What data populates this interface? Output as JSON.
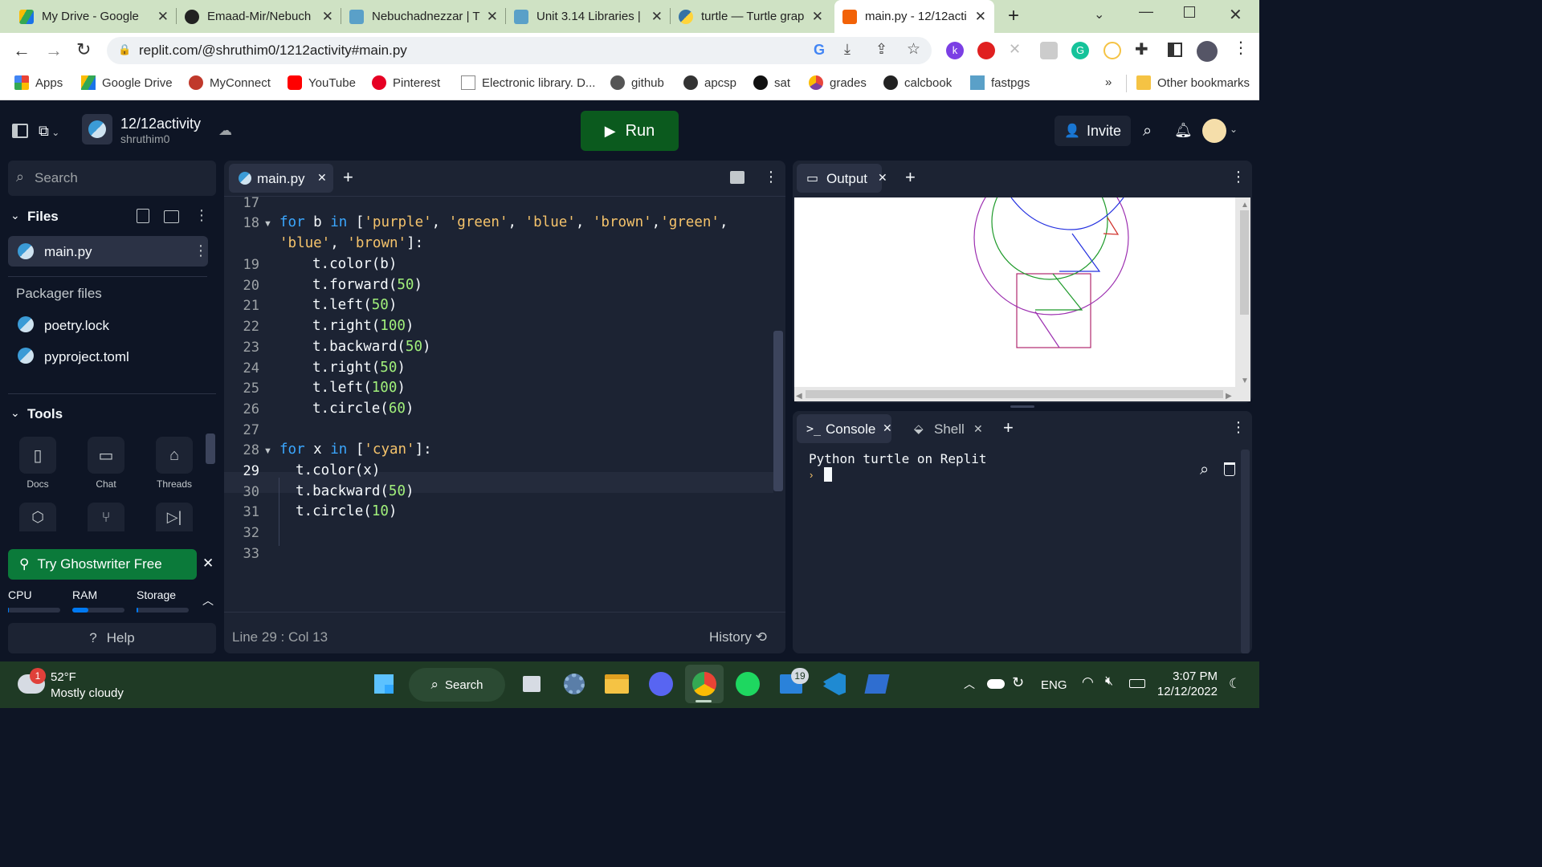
{
  "browser": {
    "tabs": [
      {
        "title": "My Drive - Google",
        "icon": "google-drive-icon",
        "color": "#1a73e8"
      },
      {
        "title": "Emaad-Mir/Nebuch",
        "icon": "github-icon",
        "color": "#222222"
      },
      {
        "title": "Nebuchadnezzar | T",
        "icon": "fastpages-icon",
        "color": "#5aa0c8"
      },
      {
        "title": "Unit 3.14 Libraries |",
        "icon": "fastpages-icon",
        "color": "#5aa0c8"
      },
      {
        "title": "turtle — Turtle grap",
        "icon": "python-icon",
        "color": "#3572a5"
      },
      {
        "title": "main.py - 12/12acti",
        "icon": "replit-icon",
        "color": "#f26207"
      }
    ],
    "url": "replit.com/@shruthim0/1212activity#main.py",
    "bookmarks": [
      {
        "label": "Apps",
        "color": "#4285f4"
      },
      {
        "label": "Google Drive",
        "color": "#fbbc04"
      },
      {
        "label": "MyConnect",
        "color": "#c0392b"
      },
      {
        "label": "YouTube",
        "color": "#ff0000"
      },
      {
        "label": "Pinterest",
        "color": "#e60023"
      },
      {
        "label": "Electronic library. D...",
        "color": "#888888"
      },
      {
        "label": "github",
        "color": "#555555"
      },
      {
        "label": "apcsp",
        "color": "#333333"
      },
      {
        "label": "sat",
        "color": "#111111"
      },
      {
        "label": "grades",
        "color": "#7b3fa0"
      },
      {
        "label": "calcbook",
        "color": "#222222"
      },
      {
        "label": "fastpgs",
        "color": "#5aa0c8"
      }
    ],
    "other_bookmarks": "Other bookmarks",
    "more": "»"
  },
  "replit": {
    "project_name": "12/12activity",
    "owner": "shruthim0",
    "run_label": "Run",
    "invite_label": "Invite",
    "search_placeholder": "Search",
    "files_label": "Files",
    "main_file": "main.py",
    "packager_label": "Packager files",
    "packager_files": [
      "poetry.lock",
      "pyproject.toml"
    ],
    "tools_label": "Tools",
    "tools": [
      "Docs",
      "Chat",
      "Threads"
    ],
    "ghostwriter_label": "Try Ghostwriter Free",
    "resources": {
      "cpu": "CPU",
      "ram": "RAM",
      "storage": "Storage",
      "cpu_level": 0.02,
      "ram_level": 0.3,
      "storage_level": 0.03
    },
    "help_label": "Help",
    "editor_tab": "main.py",
    "status_position": "Line 29 : Col 13",
    "history_label": "History",
    "output_tab": "Output",
    "console_tab": "Console",
    "shell_tab": "Shell",
    "console_text": "Python turtle on Replit"
  },
  "code_lines": [
    {
      "n": "17"
    },
    {
      "n": "18"
    },
    {
      "n": "19"
    },
    {
      "n": "20"
    },
    {
      "n": "21"
    },
    {
      "n": "22"
    },
    {
      "n": "23"
    },
    {
      "n": "24"
    },
    {
      "n": "25"
    },
    {
      "n": "26"
    },
    {
      "n": "27"
    },
    {
      "n": "28"
    },
    {
      "n": "29"
    },
    {
      "n": "30"
    },
    {
      "n": "31"
    },
    {
      "n": "32"
    },
    {
      "n": "33"
    }
  ],
  "code": {
    "l18_a": "for",
    "l18_b": " b ",
    "l18_c": "in",
    "l18_d": " [",
    "l18_s1": "'purple'",
    "l18_s2": "'green'",
    "l18_s3": "'blue'",
    "l18_s4": "'brown'",
    "l18_s5": "'green'",
    "l18_s6": "'blue'",
    "l18_s7": "'brown'",
    "l19": "t.color(b)",
    "l20_fn": "t.forward(",
    "l20_n": "50",
    "l21_fn": "t.left(",
    "l21_n": "50",
    "l22_fn": "t.right(",
    "l22_n": "100",
    "l23_fn": "t.backward(",
    "l23_n": "50",
    "l24_fn": "t.right(",
    "l24_n": "50",
    "l25_fn": "t.left(",
    "l25_n": "100",
    "l26_fn": "t.circle(",
    "l26_n": "60",
    "l28_s": "'cyan'",
    "l29": "t.color(x)",
    "l30_fn": "t.backward(",
    "l30_n": "50",
    "l31_fn": "t.circle(",
    "l31_n": "10"
  },
  "taskbar": {
    "weather_temp": "52°F",
    "weather_desc": "Mostly cloudy",
    "weather_badge": "1",
    "search_label": "Search",
    "lang": "ENG",
    "time": "3:07 PM",
    "date": "12/12/2022",
    "badge_19": "19"
  },
  "colors": {
    "run": "#0b5a1e",
    "accent": "#0079f2",
    "ghostwriter": "#0b7a3a"
  }
}
